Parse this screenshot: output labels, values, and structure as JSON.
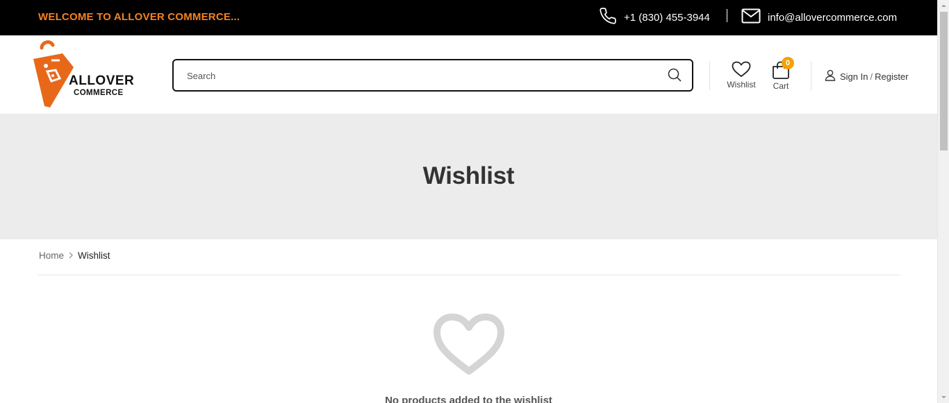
{
  "topbar": {
    "welcome_text": "WELCOME TO ALLOVER COMMERCE...",
    "phone": "+1 (830) 455-3944",
    "email": "info@allovercommerce.com",
    "accent_color": "#f5821f"
  },
  "header": {
    "logo_line_1": "ALLOVER",
    "logo_line_2": "COMMERCE",
    "search_placeholder": "Search",
    "wishlist_label": "Wishlist",
    "cart_label": "Cart",
    "cart_count": "0",
    "sign_in_label": "Sign In",
    "separator": "/",
    "register_label": "Register"
  },
  "banner": {
    "title": "Wishlist"
  },
  "breadcrumb": {
    "home": "Home",
    "current": "Wishlist"
  },
  "empty_state": {
    "message": "No products added to the wishlist"
  },
  "icons": {
    "phone": "phone-icon",
    "mail": "mail-icon",
    "search": "search-icon",
    "wishlist": "heart-icon",
    "cart": "shopping-bag-icon",
    "account": "user-icon",
    "breadcrumb_separator": "chevron-right-icon",
    "empty": "heart-outline-icon"
  },
  "colors": {
    "brand_orange": "#f5821f",
    "badge": "#f5a100",
    "banner_bg": "#ececec",
    "topbar_bg": "#000000"
  }
}
